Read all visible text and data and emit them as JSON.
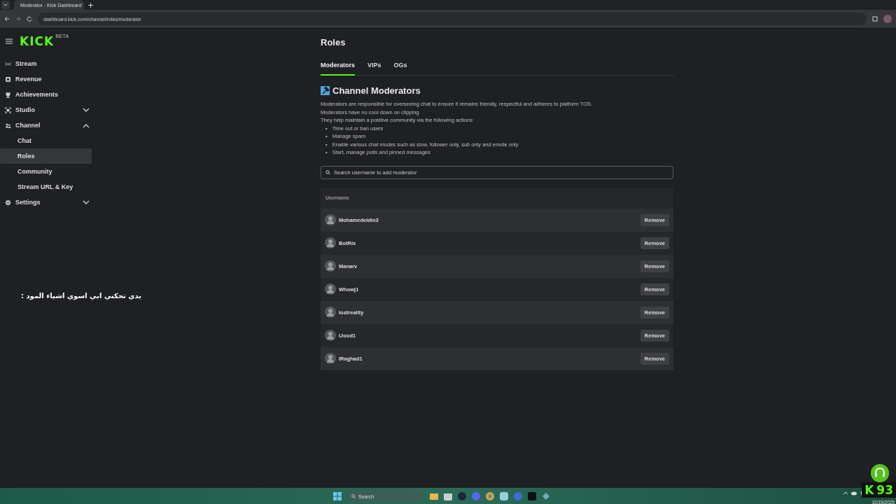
{
  "browser": {
    "tab_title": "Moderator - Kick Dashboard",
    "url": "dashboard.kick.com/channel/roles/moderator"
  },
  "header": {
    "logo": "KICK",
    "logo_badge": "BETA"
  },
  "sidebar": {
    "items": [
      {
        "label": "Stream",
        "selected": false
      },
      {
        "label": "Revenue",
        "selected": false
      },
      {
        "label": "Achievements",
        "selected": false
      },
      {
        "label": "Studio",
        "selected": false,
        "expanded": false
      },
      {
        "label": "Channel",
        "selected": false,
        "expanded": true,
        "children": [
          {
            "label": "Chat",
            "selected": false
          },
          {
            "label": "Roles",
            "selected": true
          },
          {
            "label": "Community",
            "selected": false
          },
          {
            "label": "Stream URL & Key",
            "selected": false
          }
        ]
      },
      {
        "label": "Settings",
        "selected": false,
        "expanded": false
      }
    ]
  },
  "page": {
    "title": "Roles",
    "tabs": [
      {
        "label": "Moderators",
        "selected": true
      },
      {
        "label": "VIPs",
        "selected": false
      },
      {
        "label": "OGs",
        "selected": false
      }
    ],
    "section_title": "Channel Moderators",
    "description": [
      "Moderators are responsible for overseeing chat to ensure it remains friendly, respectful and adheres to platform TOS.",
      "Moderators have no cool down on clipping.",
      "They help maintain a positive community via the following actions:"
    ],
    "bullet": "•",
    "actions": [
      "Time out or ban users",
      "Manage spam",
      "Enable various chat modes such as slow, follower only, sub only and emote only",
      "Start, manage polls and pinned messages"
    ],
    "search": {
      "placeholder": "Search username to add moderator"
    },
    "table": {
      "columns": [
        "Username"
      ],
      "rows": [
        {
          "username": "Mohamedeldin3",
          "action": "Remove"
        },
        {
          "username": "BotRix",
          "action": "Remove"
        },
        {
          "username": "Manarv",
          "action": "Remove"
        },
        {
          "username": "Whowj1",
          "action": "Remove"
        },
        {
          "username": "lostreality",
          "action": "Remove"
        },
        {
          "username": "lJood1",
          "action": "Remove"
        },
        {
          "username": "lRaghad1",
          "action": "Remove"
        }
      ]
    }
  },
  "subtitle": "يدي تحكني ابي اسوي اشياء المود :",
  "overlay": {
    "letter": "K",
    "count": "93"
  },
  "taskbar": {
    "search_placeholder": "Search",
    "date": "10/15/2025"
  }
}
